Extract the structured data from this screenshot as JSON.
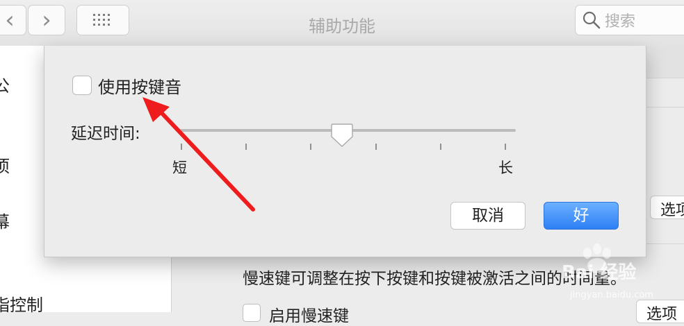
{
  "toolbar": {
    "title": "辅助功能",
    "search_placeholder": "搜索",
    "back_glyph": "‹",
    "forward_glyph": "›"
  },
  "sidebar": {
    "items": [
      {
        "label": "公"
      },
      {
        "label": "项"
      },
      {
        "label": "幕"
      },
      {
        "label": "指控制"
      }
    ]
  },
  "content": {
    "options_label_1": "选项",
    "description": "慢速键可调整在按下按键和按键被激活之间的时间量。",
    "slow_keys_label": "启用慢速键",
    "options_label_2": "选项"
  },
  "sheet": {
    "checkbox_label": "使用按键音",
    "checkbox_checked": false,
    "delay_label": "延迟时间:",
    "slider_min_label": "短",
    "slider_max_label": "长",
    "slider_value": 0.5,
    "slider_ticks": 6,
    "cancel_label": "取消",
    "ok_label": "好"
  },
  "watermark": {
    "text": "Bai 经验",
    "url": "jingyan.baidu.com"
  },
  "colors": {
    "accent": "#2d7ff5",
    "annotation_arrow": "#ee1c1c",
    "window_bg": "#ececec"
  }
}
